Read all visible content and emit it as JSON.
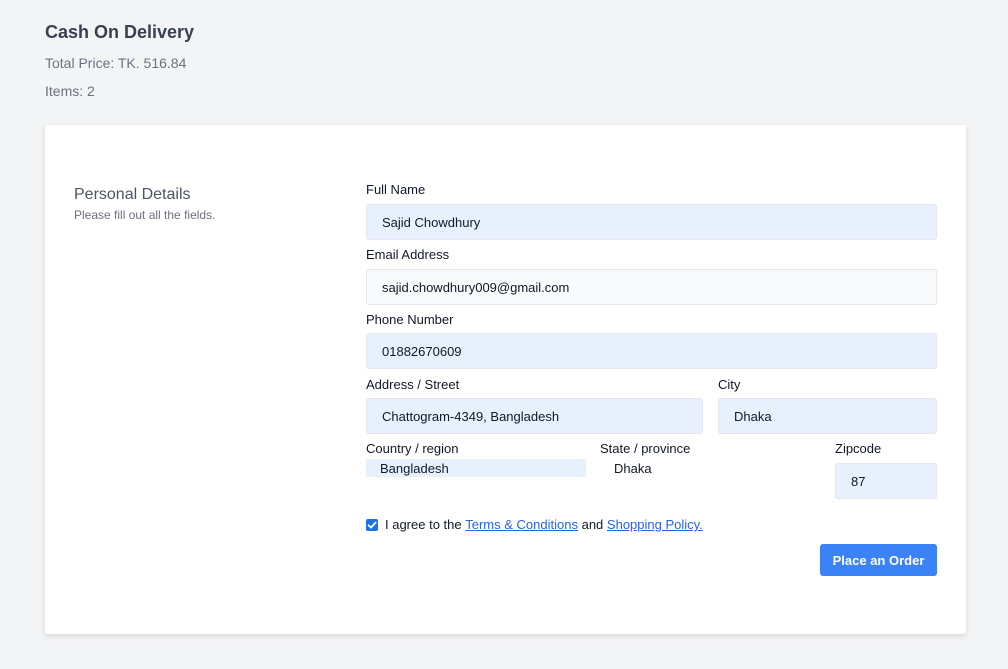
{
  "summary": {
    "title": "Cash On Delivery",
    "total_price": "Total Price: TK. 516.84",
    "items": "Items: 2"
  },
  "section": {
    "title": "Personal Details",
    "subtitle": "Please fill out all the fields."
  },
  "form": {
    "full_name": {
      "label": "Full Name",
      "value": "Sajid Chowdhury"
    },
    "email": {
      "label": "Email Address",
      "value": "sajid.chowdhury009@gmail.com"
    },
    "phone": {
      "label": "Phone Number",
      "value": "01882670609"
    },
    "address": {
      "label": "Address / Street",
      "value": "Chattogram-4349, Bangladesh"
    },
    "city": {
      "label": "City",
      "value": "Dhaka"
    },
    "country": {
      "label": "Country / region",
      "value": "Bangladesh"
    },
    "state": {
      "label": "State / province",
      "value": "Dhaka"
    },
    "zipcode": {
      "label": "Zipcode",
      "value": "87"
    }
  },
  "agreement": {
    "checked": true,
    "prefix": "I agree to the",
    "terms_link": "Terms & Conditions",
    "conjunction": "and",
    "policy_link": "Shopping Policy."
  },
  "actions": {
    "place_order": "Place an Order"
  },
  "colors": {
    "accent": "#3b82f6",
    "field_bg": "#e8f0fe",
    "page_bg": "#f3f4f6"
  }
}
